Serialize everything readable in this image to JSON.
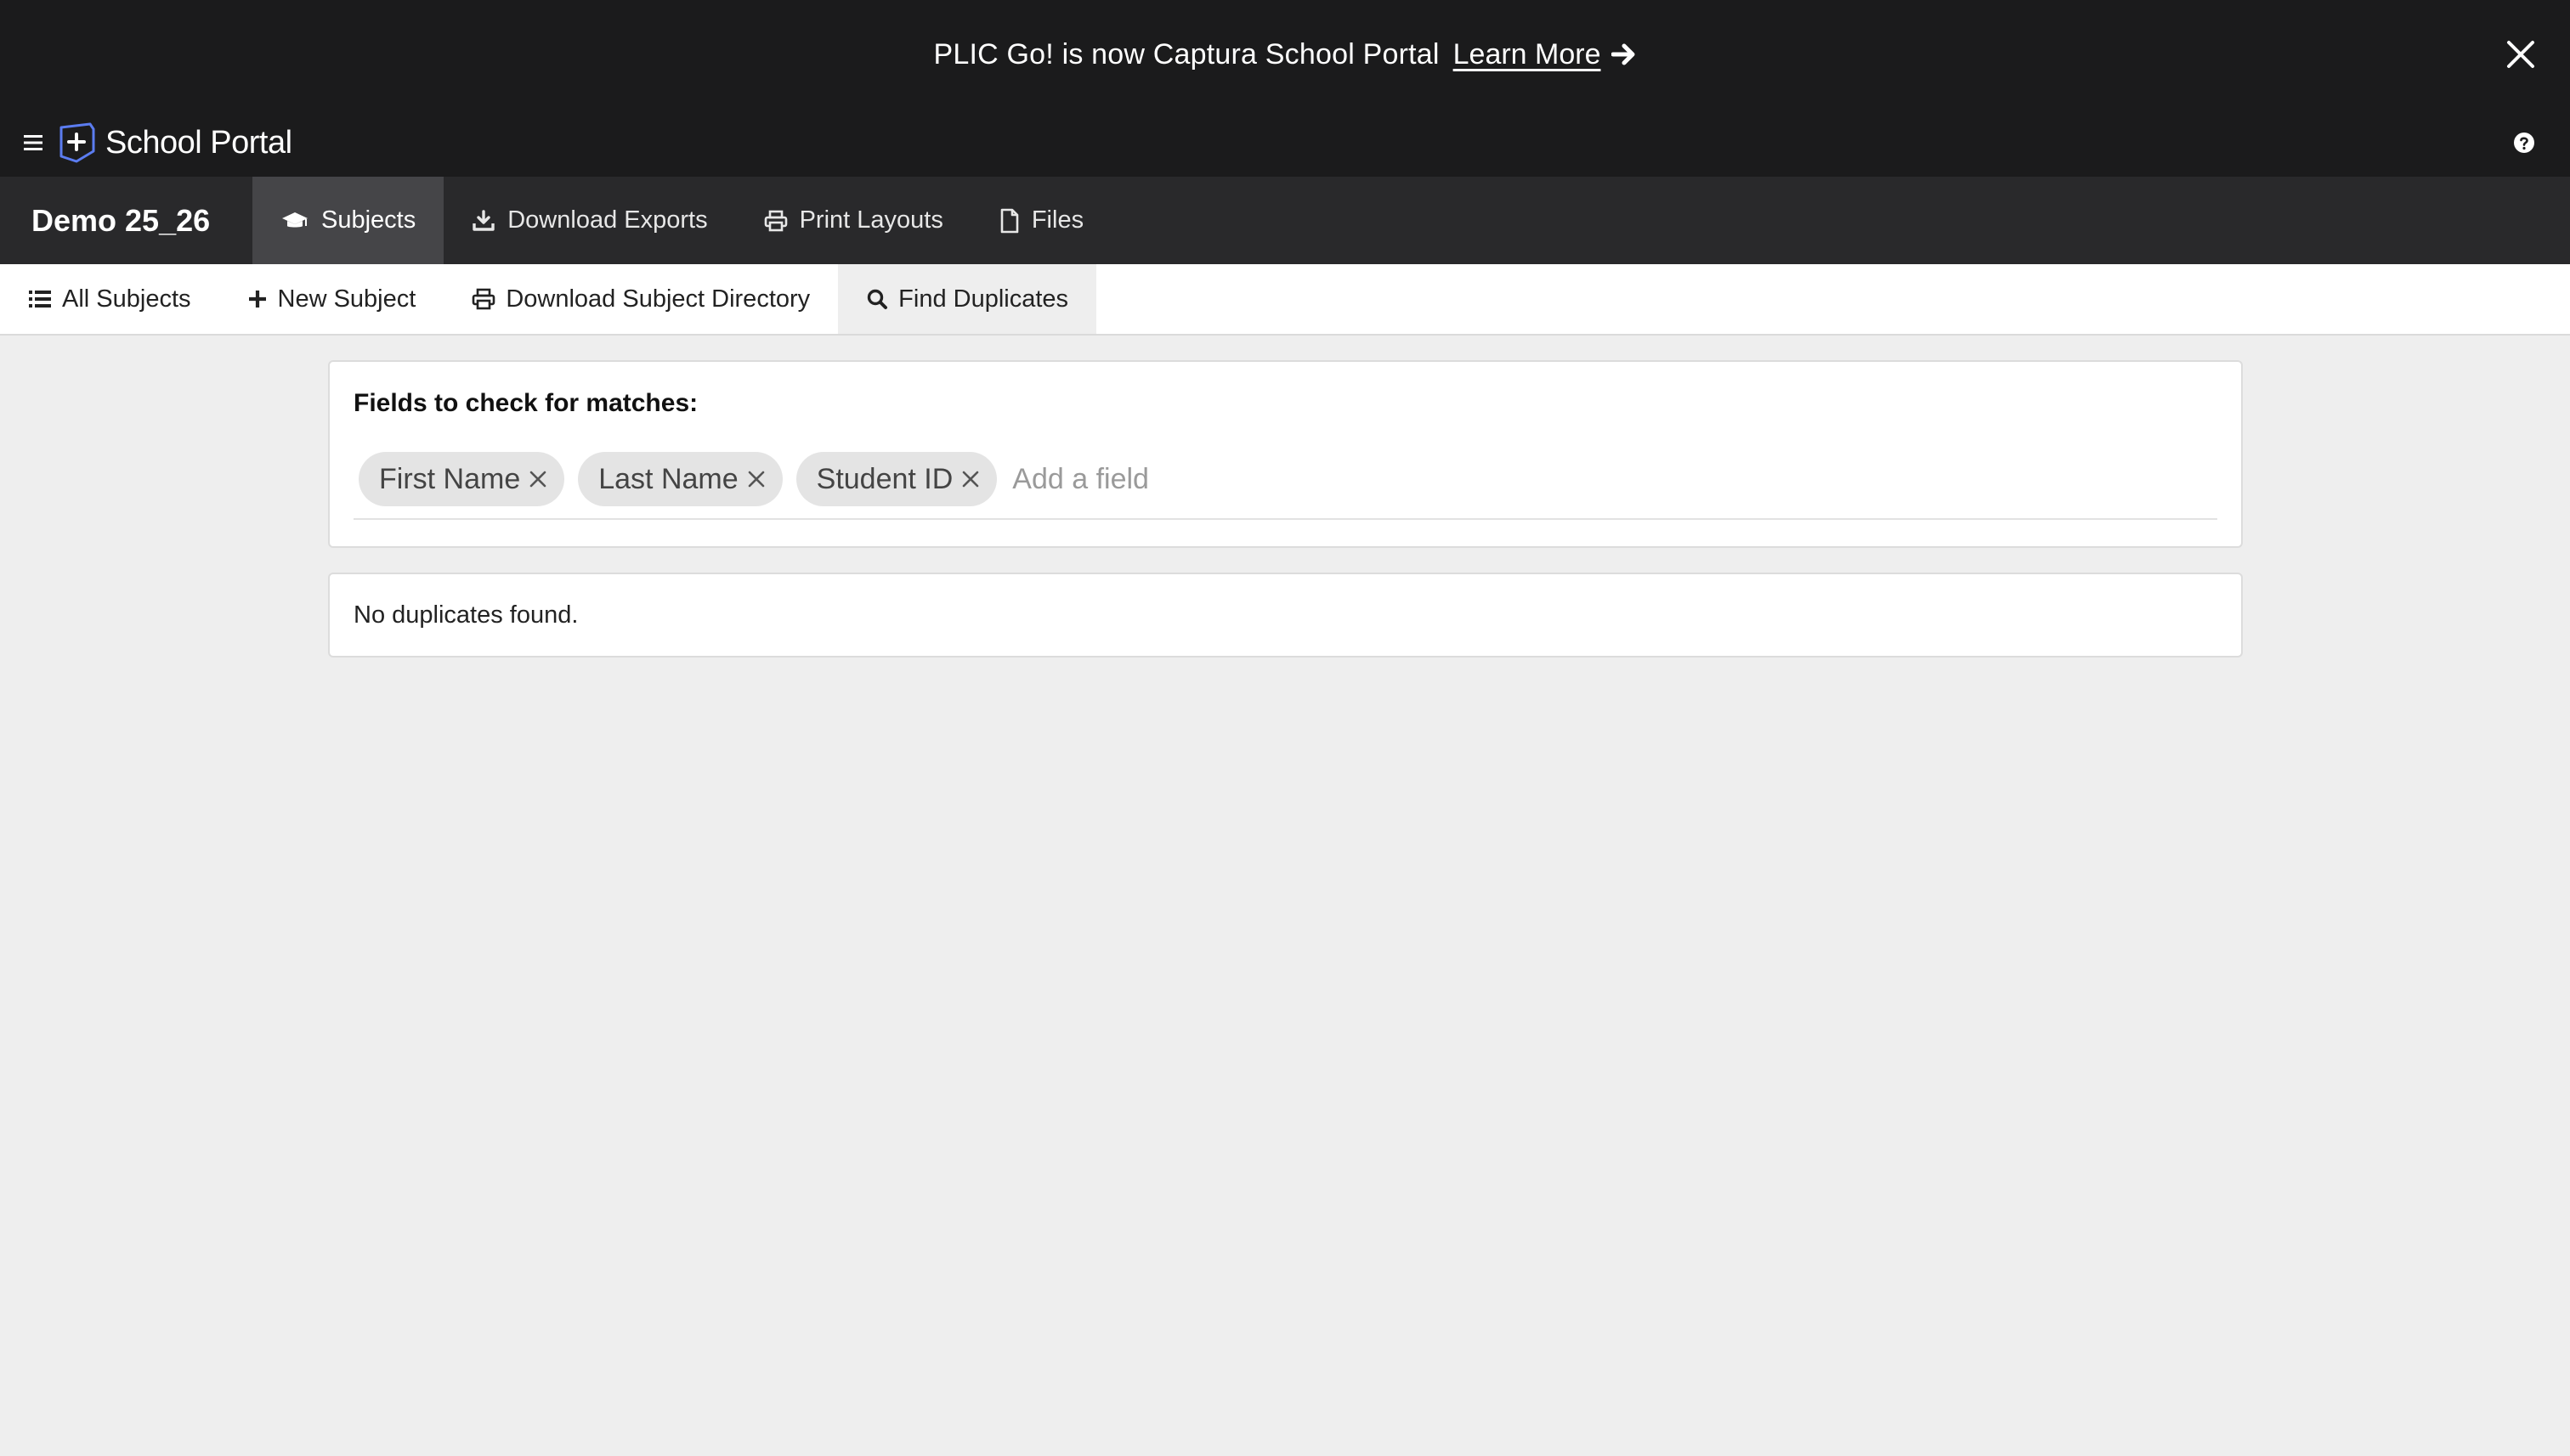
{
  "banner": {
    "message": "PLIC Go! is now Captura School Portal",
    "link_label": "Learn More",
    "link_icon": "arrow-right-icon",
    "close_icon": "close-icon"
  },
  "app": {
    "name": "School Portal",
    "menu_icon": "hamburger-icon",
    "logo_icon": "shield-plus-logo",
    "help_icon": "question-circle-icon",
    "accent_color": "#5b7cf0"
  },
  "primary_nav": {
    "project": "Demo 25_26",
    "tabs": [
      {
        "label": "Subjects",
        "icon": "graduation-cap-icon",
        "active": true
      },
      {
        "label": "Download Exports",
        "icon": "download-icon",
        "active": false
      },
      {
        "label": "Print Layouts",
        "icon": "printer-icon",
        "active": false
      },
      {
        "label": "Files",
        "icon": "file-icon",
        "active": false
      }
    ]
  },
  "secondary_nav": {
    "items": [
      {
        "label": "All Subjects",
        "icon": "list-icon",
        "active": false
      },
      {
        "label": "New Subject",
        "icon": "plus-icon",
        "active": false
      },
      {
        "label": "Download Subject Directory",
        "icon": "printer-icon",
        "active": false
      },
      {
        "label": "Find Duplicates",
        "icon": "search-icon",
        "active": true
      }
    ]
  },
  "duplicates": {
    "heading": "Fields to check for matches:",
    "fields": [
      "First Name",
      "Last Name",
      "Student ID"
    ],
    "input_placeholder": "Add a field",
    "input_value": "",
    "result_message": "No duplicates found."
  }
}
